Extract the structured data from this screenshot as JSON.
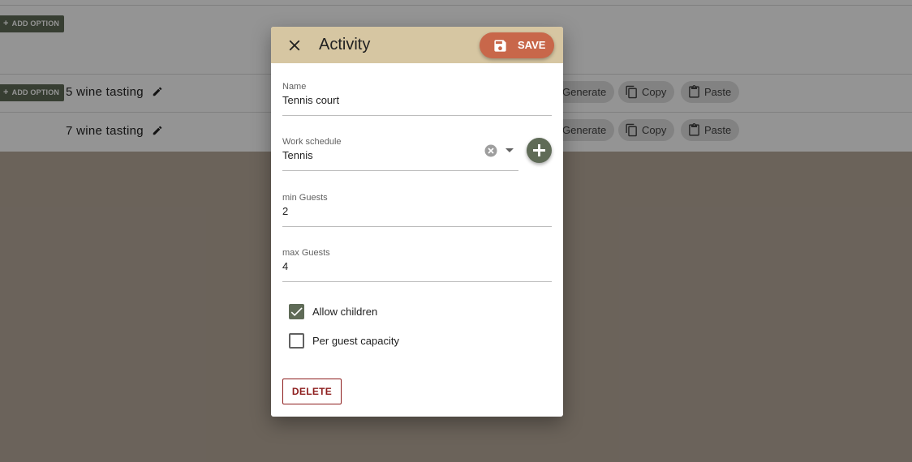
{
  "background": {
    "add_option_label": "ADD OPTION",
    "rows": [
      {
        "title": "5 wine tasting",
        "generate": "Generate",
        "copy": "Copy",
        "paste": "Paste"
      },
      {
        "title": "7 wine tasting",
        "generate": "Generate",
        "copy": "Copy",
        "paste": "Paste"
      }
    ]
  },
  "dialog": {
    "title": "Activity",
    "save_label": "SAVE",
    "fields": {
      "name": {
        "label": "Name",
        "value": "Tennis court"
      },
      "work_schedule": {
        "label": "Work schedule",
        "value": "Tennis"
      },
      "min_guests": {
        "label": "min Guests",
        "value": "2"
      },
      "max_guests": {
        "label": "max Guests",
        "value": "4"
      }
    },
    "checkboxes": {
      "allow_children": {
        "label": "Allow children",
        "checked": true
      },
      "per_guest_capacity": {
        "label": "Per guest capacity",
        "checked": false
      }
    },
    "delete_label": "DELETE"
  },
  "colors": {
    "accent_green": "#5f6b57",
    "header_tan": "#d6c6a2",
    "save_orange": "#c8674a",
    "delete_red": "#8d1d1d"
  },
  "icons": [
    "close-icon",
    "save-icon",
    "pencil-icon",
    "copy-icon",
    "paste-icon",
    "clear-icon",
    "dropdown-arrow-icon",
    "plus-icon",
    "check-icon"
  ]
}
